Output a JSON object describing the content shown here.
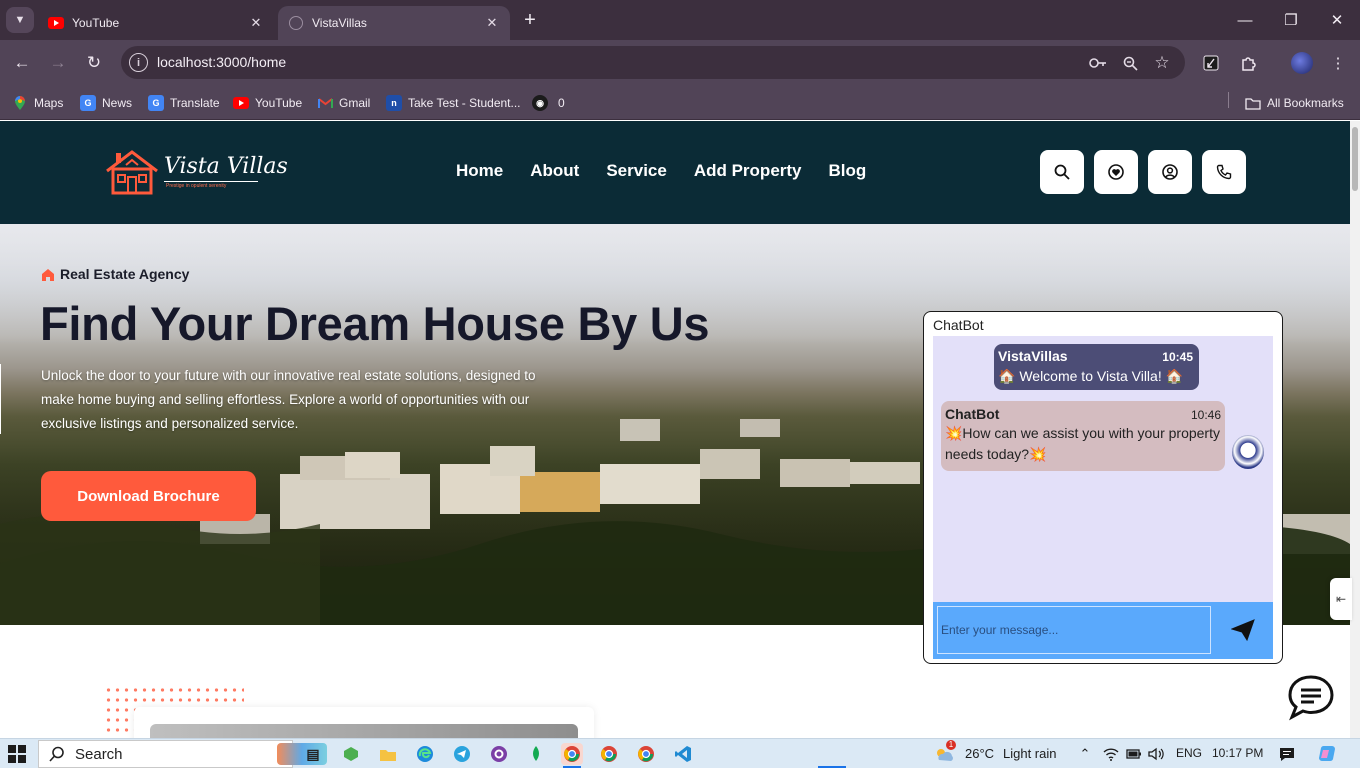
{
  "browser": {
    "tabs": [
      {
        "title": "YouTube",
        "icon": "youtube-icon",
        "active": false
      },
      {
        "title": "VistaVillas",
        "icon": "globe-icon",
        "active": true
      }
    ],
    "url": "localhost:3000/home",
    "bookmarks": [
      {
        "label": "Maps",
        "icon": "maps-icon"
      },
      {
        "label": "News",
        "icon": "news-icon"
      },
      {
        "label": "Translate",
        "icon": "translate-icon"
      },
      {
        "label": "YouTube",
        "icon": "youtube-icon"
      },
      {
        "label": "Gmail",
        "icon": "gmail-icon"
      },
      {
        "label": "Take Test - Student...",
        "icon": "notion-icon"
      },
      {
        "label": "0",
        "icon": "github-icon"
      }
    ],
    "all_bookmarks": "All Bookmarks"
  },
  "site": {
    "logo_text": "Vista Villas",
    "logo_tagline": "Prestige in opulent serenity",
    "nav": [
      "Home",
      "About",
      "Service",
      "Add Property",
      "Blog"
    ],
    "header_buttons": [
      "search-icon",
      "location-icon",
      "user-icon",
      "phone-icon"
    ],
    "accent_color": "#ff5a3c",
    "header_color": "#0b2b36"
  },
  "hero": {
    "tag": "Real Estate Agency",
    "title": "Find Your Dream House By Us",
    "description": "Unlock the door to your future with our innovative real estate solutions, designed to make home buying and selling effortless. Explore a world of opportunities with our exclusive listings and personalized service.",
    "button": "Download Brochure"
  },
  "chatbot": {
    "title": "ChatBot",
    "messages": [
      {
        "sender": "VistaVillas",
        "time": "10:45",
        "text": "🏠 Welcome to Vista Villa! 🏠"
      },
      {
        "sender": "ChatBot",
        "time": "10:46",
        "text": "💥How can we assist you with your property needs today?💥"
      }
    ],
    "input_placeholder": "Enter your message..."
  },
  "taskbar": {
    "search_label": "Search",
    "weather": "26°C",
    "weather_desc": "Light rain",
    "weather_badge": "1",
    "language": "ENG",
    "time": "10:17 PM"
  }
}
